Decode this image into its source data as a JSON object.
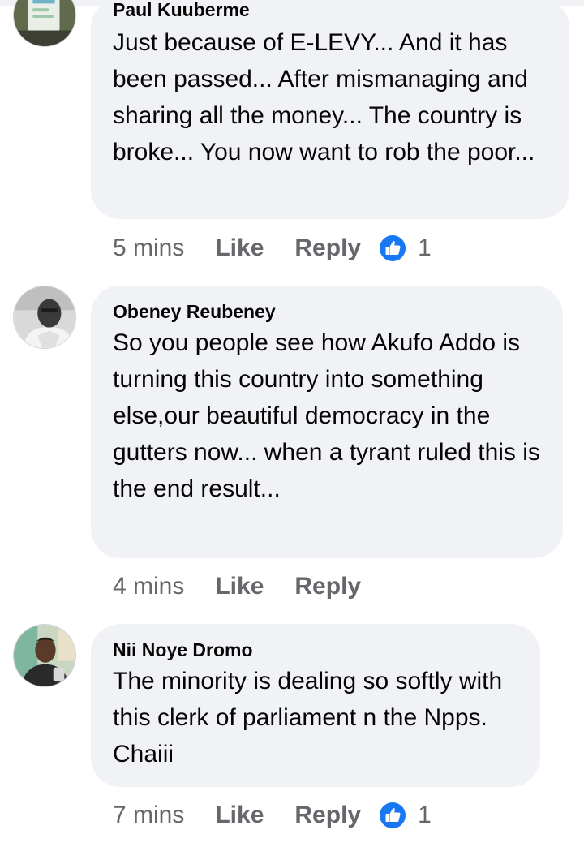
{
  "comments": [
    {
      "author": "Paul Kuuberme",
      "text": "Just because of E-LEVY... And it has been passed... After mismanaging and sharing all the money... The country is broke... You now want to rob the poor...",
      "time": "5 mins",
      "like_label": "Like",
      "reply_label": "Reply",
      "reaction_icon": "thumbs-up-icon",
      "reaction_count": "1"
    },
    {
      "author": "Obeney Reubeney",
      "text": "So you people see how Akufo Addo is turning this country into something else,our beautiful democracy in the gutters now... when a tyrant ruled this is the end result...",
      "time": "4 mins",
      "like_label": "Like",
      "reply_label": "Reply"
    },
    {
      "author": "Nii Noye Dromo",
      "text": "The minority is dealing so softly with this clerk of parliament n the Npps. Chaiii",
      "time": "7 mins",
      "like_label": "Like",
      "reply_label": "Reply",
      "reaction_icon": "thumbs-up-icon",
      "reaction_count": "1"
    }
  ],
  "colors": {
    "bubble": "#f0f2f5",
    "meta_text": "#65676b",
    "like_blue": "#1877f2"
  }
}
